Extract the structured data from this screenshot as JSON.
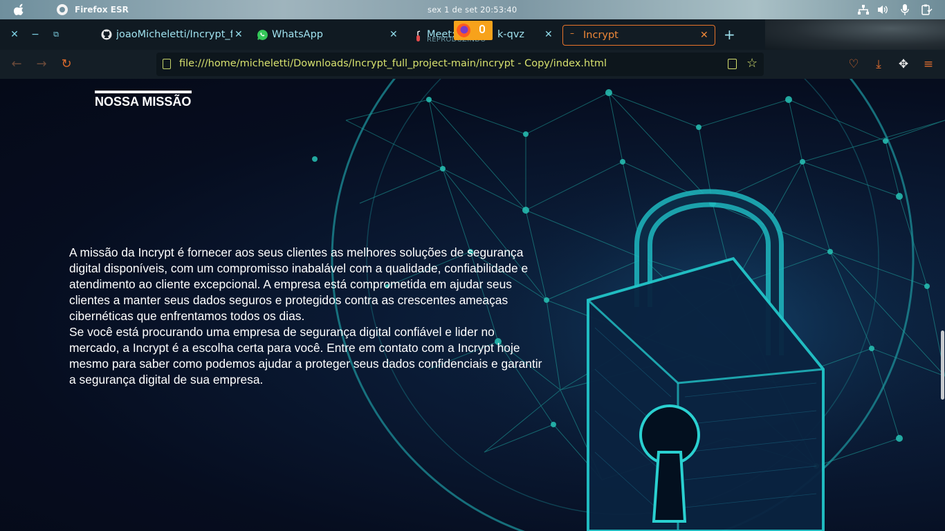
{
  "system_bar": {
    "app_name": "Firefox ESR",
    "clock": "sex 1 de set  20:53:40",
    "tray_icons": [
      "network-icon",
      "volume-icon",
      "microphone-icon",
      "clipboard-icon"
    ]
  },
  "tabs": [
    {
      "label": "joaoMicheletti/Incrypt_fu",
      "icon": "github-icon",
      "active": false
    },
    {
      "label": "WhatsApp",
      "icon": "whatsapp-icon",
      "active": false
    },
    {
      "label": "Meet: ",
      "label_tail": "k-qvz",
      "sublabel": "REPRODUZINDO",
      "icon": "microphone-muted-icon",
      "active": false
    },
    {
      "label": "Incrypt",
      "icon": "loading-icon",
      "active": true
    }
  ],
  "navbar": {
    "url": "file:///home/micheletti/Downloads/Incrypt_full_project-main/incrypt - Copy/index.html"
  },
  "page": {
    "section_title": "NOSSA MISSÃO",
    "paragraph_1": "A missão da Incrypt é fornecer aos seus clientes as melhores soluções de segurança digital disponíveis, com um compromisso inabalável com a qualidade, confiabilidade e atendimento ao cliente excepcional. A empresa está comprometida em ajudar seus clientes a manter seus dados seguros e protegidos contra as crescentes ameaças cibernéticas que enfrentamos todos os dias.",
    "paragraph_2": "Se você está procurando uma empresa de segurança digital confiável e lider no mercado, a Incrypt é a escolha certa para você. Entre em contato com a Incrypt hoje mesmo para saber como podemos ajudar a proteger seus dados confidenciais e garantir a segurança digital de sua empresa."
  },
  "colors": {
    "accent": "#e8742a",
    "url_text": "#d6e06e",
    "tab_text": "#9fe1ee",
    "background_glow": "#0e2a4a",
    "network_line": "#1fa7a0"
  }
}
